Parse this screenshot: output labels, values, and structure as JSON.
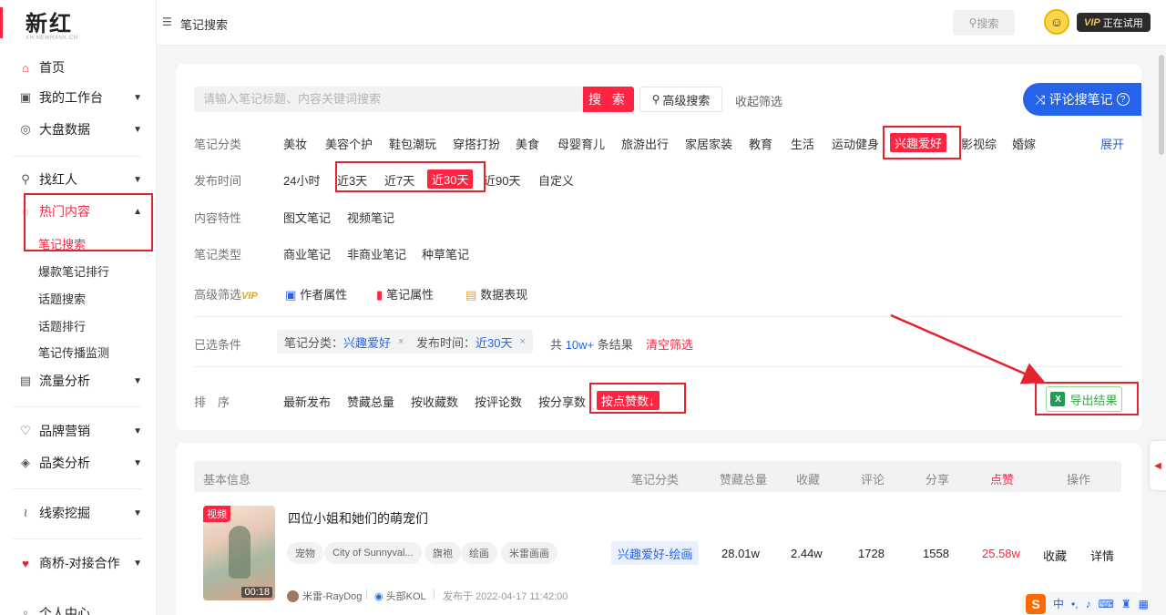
{
  "brand": {
    "name": "新红",
    "sub": "XH.NEWRANK.CN"
  },
  "sidebar": {
    "items": [
      {
        "label": "首页",
        "icon": "home-icon",
        "glyph": "⌂"
      },
      {
        "label": "我的工作台",
        "icon": "workbench-icon",
        "glyph": "▣"
      },
      {
        "label": "大盘数据",
        "icon": "dashboard-icon",
        "glyph": "◎"
      },
      {
        "label": "找红人",
        "icon": "search-person-icon",
        "glyph": "⚲"
      },
      {
        "label": "热门内容",
        "icon": "fire-icon",
        "glyph": "◌"
      },
      {
        "label": "流量分析",
        "icon": "traffic-icon",
        "glyph": "▤"
      },
      {
        "label": "品牌营销",
        "icon": "brand-icon",
        "glyph": "♡"
      },
      {
        "label": "品类分析",
        "icon": "category-tag-icon",
        "glyph": "◈"
      },
      {
        "label": "线索挖掘",
        "icon": "leads-icon",
        "glyph": "≀"
      },
      {
        "label": "商桥-对接合作",
        "icon": "bridge-icon",
        "glyph": "♥"
      },
      {
        "label": "个人中心",
        "icon": "user-icon",
        "glyph": "♀"
      }
    ],
    "sub_items": [
      "笔记搜索",
      "爆款笔记排行",
      "话题搜索",
      "话题排行",
      "笔记传播监测"
    ]
  },
  "header": {
    "title": "笔记搜索",
    "search_label": "搜索",
    "vip_badge": "VIP",
    "vip_text": "正在试用"
  },
  "search": {
    "placeholder": "请输入笔记标题、内容关键词搜索",
    "button": "搜 索",
    "advanced": "高级搜索",
    "collapse": "收起筛选",
    "comment_search": "评论搜笔记"
  },
  "filters": {
    "category_label": "笔记分类",
    "categories": [
      "美妆",
      "美容个护",
      "鞋包潮玩",
      "穿搭打扮",
      "美食",
      "母婴育儿",
      "旅游出行",
      "家居家装",
      "教育",
      "生活",
      "运动健身",
      "兴趣爱好",
      "影视综",
      "婚嫁"
    ],
    "expand": "展开",
    "time_label": "发布时间",
    "times": [
      "24小时",
      "近3天",
      "近7天",
      "近30天",
      "近90天",
      "自定义"
    ],
    "feature_label": "内容特性",
    "features": [
      "图文笔记",
      "视频笔记"
    ],
    "type_label": "笔记类型",
    "types": [
      "商业笔记",
      "非商业笔记",
      "种草笔记"
    ],
    "advanced_label": "高级筛选",
    "advanced_vip": "VIP",
    "advanced_opts": [
      "作者属性",
      "笔记属性",
      "数据表现"
    ]
  },
  "selected": {
    "label": "已选条件",
    "chip1_key": "笔记分类：",
    "chip1_val": "兴趣爱好",
    "chip2_key": "发布时间：",
    "chip2_val": "近30天",
    "total_prefix": "共",
    "total": "10w+",
    "total_suffix": "条结果",
    "clear": "清空筛选"
  },
  "sort": {
    "label": "排　序",
    "options": [
      "最新发布",
      "赞藏总量",
      "按收藏数",
      "按评论数",
      "按分享数",
      "按点赞数"
    ],
    "active_arrow": "↓",
    "export": "导出结果"
  },
  "table": {
    "headers": [
      "基本信息",
      "笔记分类",
      "赞藏总量",
      "收藏",
      "评论",
      "分享",
      "点赞",
      "操作"
    ],
    "rows": [
      {
        "thumb_tag": "视频",
        "duration": "00:18",
        "title": "四位小姐和她们的萌宠们",
        "tags": [
          "宠物",
          "City of Sunnyval...",
          "旗袍",
          "绘画",
          "米雷画画"
        ],
        "author": "米雷-RayDog",
        "level": "头部KOL",
        "published": "发布于 2022-04-17 11:42:00",
        "category": "兴趣爱好-绘画",
        "likes_total": "28.01w",
        "collects": "2.44w",
        "comments": "1728",
        "shares": "1558",
        "likes": "25.58w",
        "action_collect": "收藏",
        "action_detail": "详情"
      }
    ]
  },
  "ime": {
    "logo": "S",
    "lang": "中"
  },
  "colors": {
    "accent": "#ff2442",
    "link": "#2563eb",
    "annotation": "#e5232e",
    "export": "#3aa548"
  }
}
